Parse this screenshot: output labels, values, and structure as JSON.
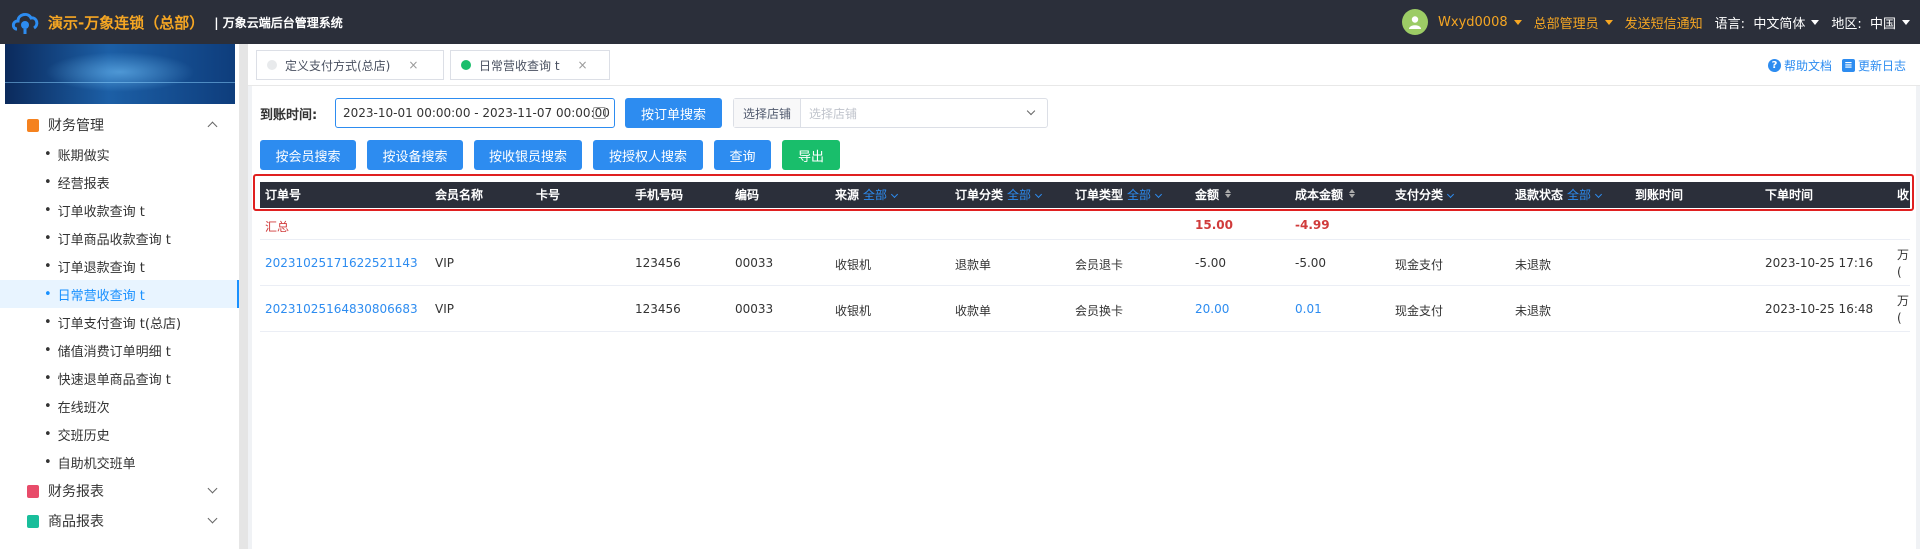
{
  "header": {
    "brand": "演示-万象连锁（总部）",
    "system": "| 万象云端后台管理系统",
    "user": "Wxyd0008",
    "role": "总部管理员",
    "notify": "发送短信通知",
    "lang_label": "语言:",
    "lang_value": "中文简体",
    "region_label": "地区:",
    "region_value": "中国"
  },
  "sidebar": {
    "group_finance": "财务管理",
    "items": [
      {
        "label": "账期做实"
      },
      {
        "label": "经营报表"
      },
      {
        "label": "订单收款查询 t"
      },
      {
        "label": "订单商品收款查询 t"
      },
      {
        "label": "订单退款查询 t"
      },
      {
        "label": "日常营收查询 t"
      },
      {
        "label": "订单支付查询 t(总店)"
      },
      {
        "label": "储值消费订单明细 t"
      },
      {
        "label": "快速退单商品查询 t"
      },
      {
        "label": "在线班次"
      },
      {
        "label": "交班历史"
      },
      {
        "label": "自助机交班单"
      }
    ],
    "group_report": "财务报表",
    "group_goods": "商品报表",
    "bullet": "•",
    "colors": {
      "finance_icon": "#f5821f",
      "report_icon": "#e84c6a",
      "goods_icon": "#19be9b"
    }
  },
  "tabs": [
    {
      "label": "定义支付方式(总店)",
      "close": "×",
      "active": false
    },
    {
      "label": "日常营收查询 t",
      "close": "×",
      "active": true
    }
  ],
  "help": {
    "doc": "帮助文档",
    "changelog": "更新日志",
    "doc_icon": "?",
    "log_icon": "≡"
  },
  "filters": {
    "date_label": "到账时间:",
    "date_value": "2023-10-01 00:00:00 - 2023-11-07 00:00:00",
    "btn_order": "按订单搜索",
    "store_label": "选择店铺",
    "store_placeholder": "选择店铺",
    "btn_member": "按会员搜索",
    "btn_device": "按设备搜索",
    "btn_cashier": "按收银员搜索",
    "btn_authorizer": "按授权人搜索",
    "btn_query": "查询",
    "btn_export": "导出"
  },
  "table": {
    "headers": {
      "order_no": "订单号",
      "member": "会员名称",
      "card": "卡号",
      "phone": "手机号码",
      "code": "编码",
      "source": "来源",
      "order_cat": "订单分类",
      "order_type": "订单类型",
      "amount": "金额",
      "cost": "成本金额",
      "pay_cat": "支付分类",
      "refund_status": "退款状态",
      "arrive_time": "到账时间",
      "order_time": "下单时间",
      "last": "收"
    },
    "filter_all": "全部",
    "summary": {
      "label": "汇总",
      "amount": "15.00",
      "cost": "-4.99"
    },
    "rows": [
      {
        "order_no": "20231025171622521143",
        "member": "VIP",
        "card": "",
        "phone": "123456",
        "code": "00033",
        "source": "收银机",
        "order_cat": "退款单",
        "order_type": "会员退卡",
        "amount": "-5.00",
        "cost": "-5.00",
        "pay_cat": "现金支付",
        "refund_status": "未退款",
        "arrive_time": "",
        "order_time": "2023-10-25 17:16",
        "clip1": "万",
        "clip2": "("
      },
      {
        "order_no": "20231025164830806683",
        "member": "VIP",
        "card": "",
        "phone": "123456",
        "code": "00033",
        "source": "收银机",
        "order_cat": "收款单",
        "order_type": "会员换卡",
        "amount": "20.00",
        "cost": "0.01",
        "pay_cat": "现金支付",
        "refund_status": "未退款",
        "arrive_time": "",
        "order_time": "2023-10-25 16:48",
        "clip1": "万",
        "clip2": "("
      }
    ]
  },
  "colors": {
    "accent": "#2d8cf0",
    "topbar": "#2b2f3a",
    "brand": "#f5a623",
    "export": "#19be6b",
    "highlight": "#e02020"
  }
}
